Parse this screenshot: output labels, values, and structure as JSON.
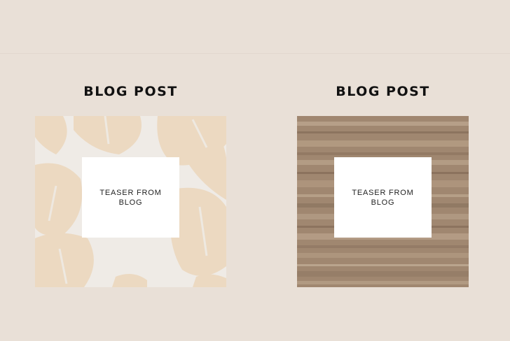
{
  "colors": {
    "background": "#e9e0d7",
    "leaf_bg": "#efebe6",
    "leaf": "#ecd9c1",
    "marble_base": "#a08770",
    "teaser_bg": "#ffffff",
    "title": "#111111"
  },
  "posts": [
    {
      "title": "BLOG POST",
      "teaser": "TEASER FROM BLOG",
      "image": "monstera-leaf-pattern"
    },
    {
      "title": "BLOG POST",
      "teaser": "TEASER FROM BLOG",
      "image": "travertine-marble-texture"
    }
  ]
}
